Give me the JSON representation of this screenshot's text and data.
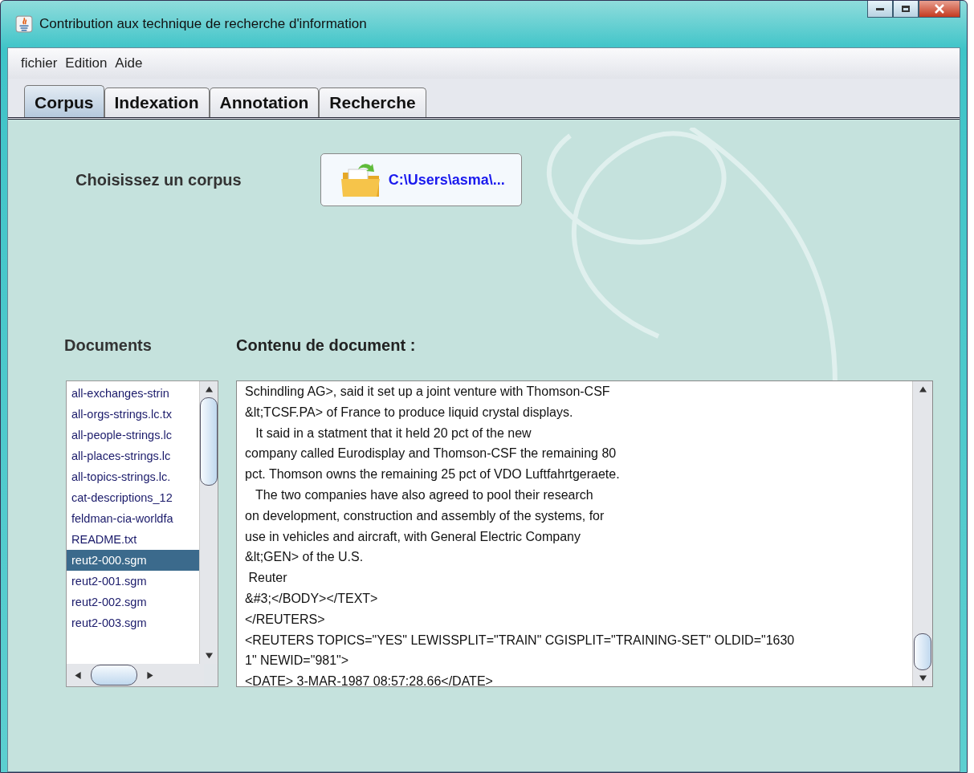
{
  "window": {
    "title": "Contribution aux technique de recherche d'information"
  },
  "menu": [
    "fichier",
    "Edition",
    "Aide"
  ],
  "tabs": [
    {
      "label": "Corpus",
      "selected": true
    },
    {
      "label": "Indexation",
      "selected": false
    },
    {
      "label": "Annotation",
      "selected": false
    },
    {
      "label": "Recherche",
      "selected": false
    }
  ],
  "corpus": {
    "label": "Choisissez un corpus",
    "button": "C:\\Users\\asma\\..."
  },
  "documents": {
    "heading": "Documents",
    "items": [
      {
        "name": "all-exchanges-strin",
        "selected": false
      },
      {
        "name": "all-orgs-strings.lc.tx",
        "selected": false
      },
      {
        "name": "all-people-strings.lc",
        "selected": false
      },
      {
        "name": "all-places-strings.lc",
        "selected": false
      },
      {
        "name": "all-topics-strings.lc.",
        "selected": false
      },
      {
        "name": "cat-descriptions_12",
        "selected": false
      },
      {
        "name": "feldman-cia-worldfa",
        "selected": false
      },
      {
        "name": "README.txt",
        "selected": false
      },
      {
        "name": "reut2-000.sgm",
        "selected": true
      },
      {
        "name": "reut2-001.sgm",
        "selected": false
      },
      {
        "name": "reut2-002.sgm",
        "selected": false
      },
      {
        "name": "reut2-003.sgm",
        "selected": false
      }
    ]
  },
  "content": {
    "heading": "Contenu de document :",
    "lines": [
      "Schindling AG>, said it set up a joint venture with Thomson-CSF",
      "&lt;TCSF.PA> of France to produce liquid crystal displays.",
      "   It said in a statment that it held 20 pct of the new",
      "company called Eurodisplay and Thomson-CSF the remaining 80",
      "pct. Thomson owns the remaining 25 pct of VDO Luftfahrtgeraete.",
      "   The two companies have also agreed to pool their research",
      "on development, construction and assembly of the systems, for",
      "use in vehicles and aircraft, with General Electric Company",
      "&lt;GEN> of the U.S.",
      " Reuter",
      "&#3;</BODY></TEXT>",
      "</REUTERS>",
      "<REUTERS TOPICS=\"YES\" LEWISSPLIT=\"TRAIN\" CGISPLIT=\"TRAINING-SET\" OLDID=\"1630",
      "1\" NEWID=\"981\">",
      "<DATE> 3-MAR-1987 08:57:28.66</DATE>"
    ]
  }
}
